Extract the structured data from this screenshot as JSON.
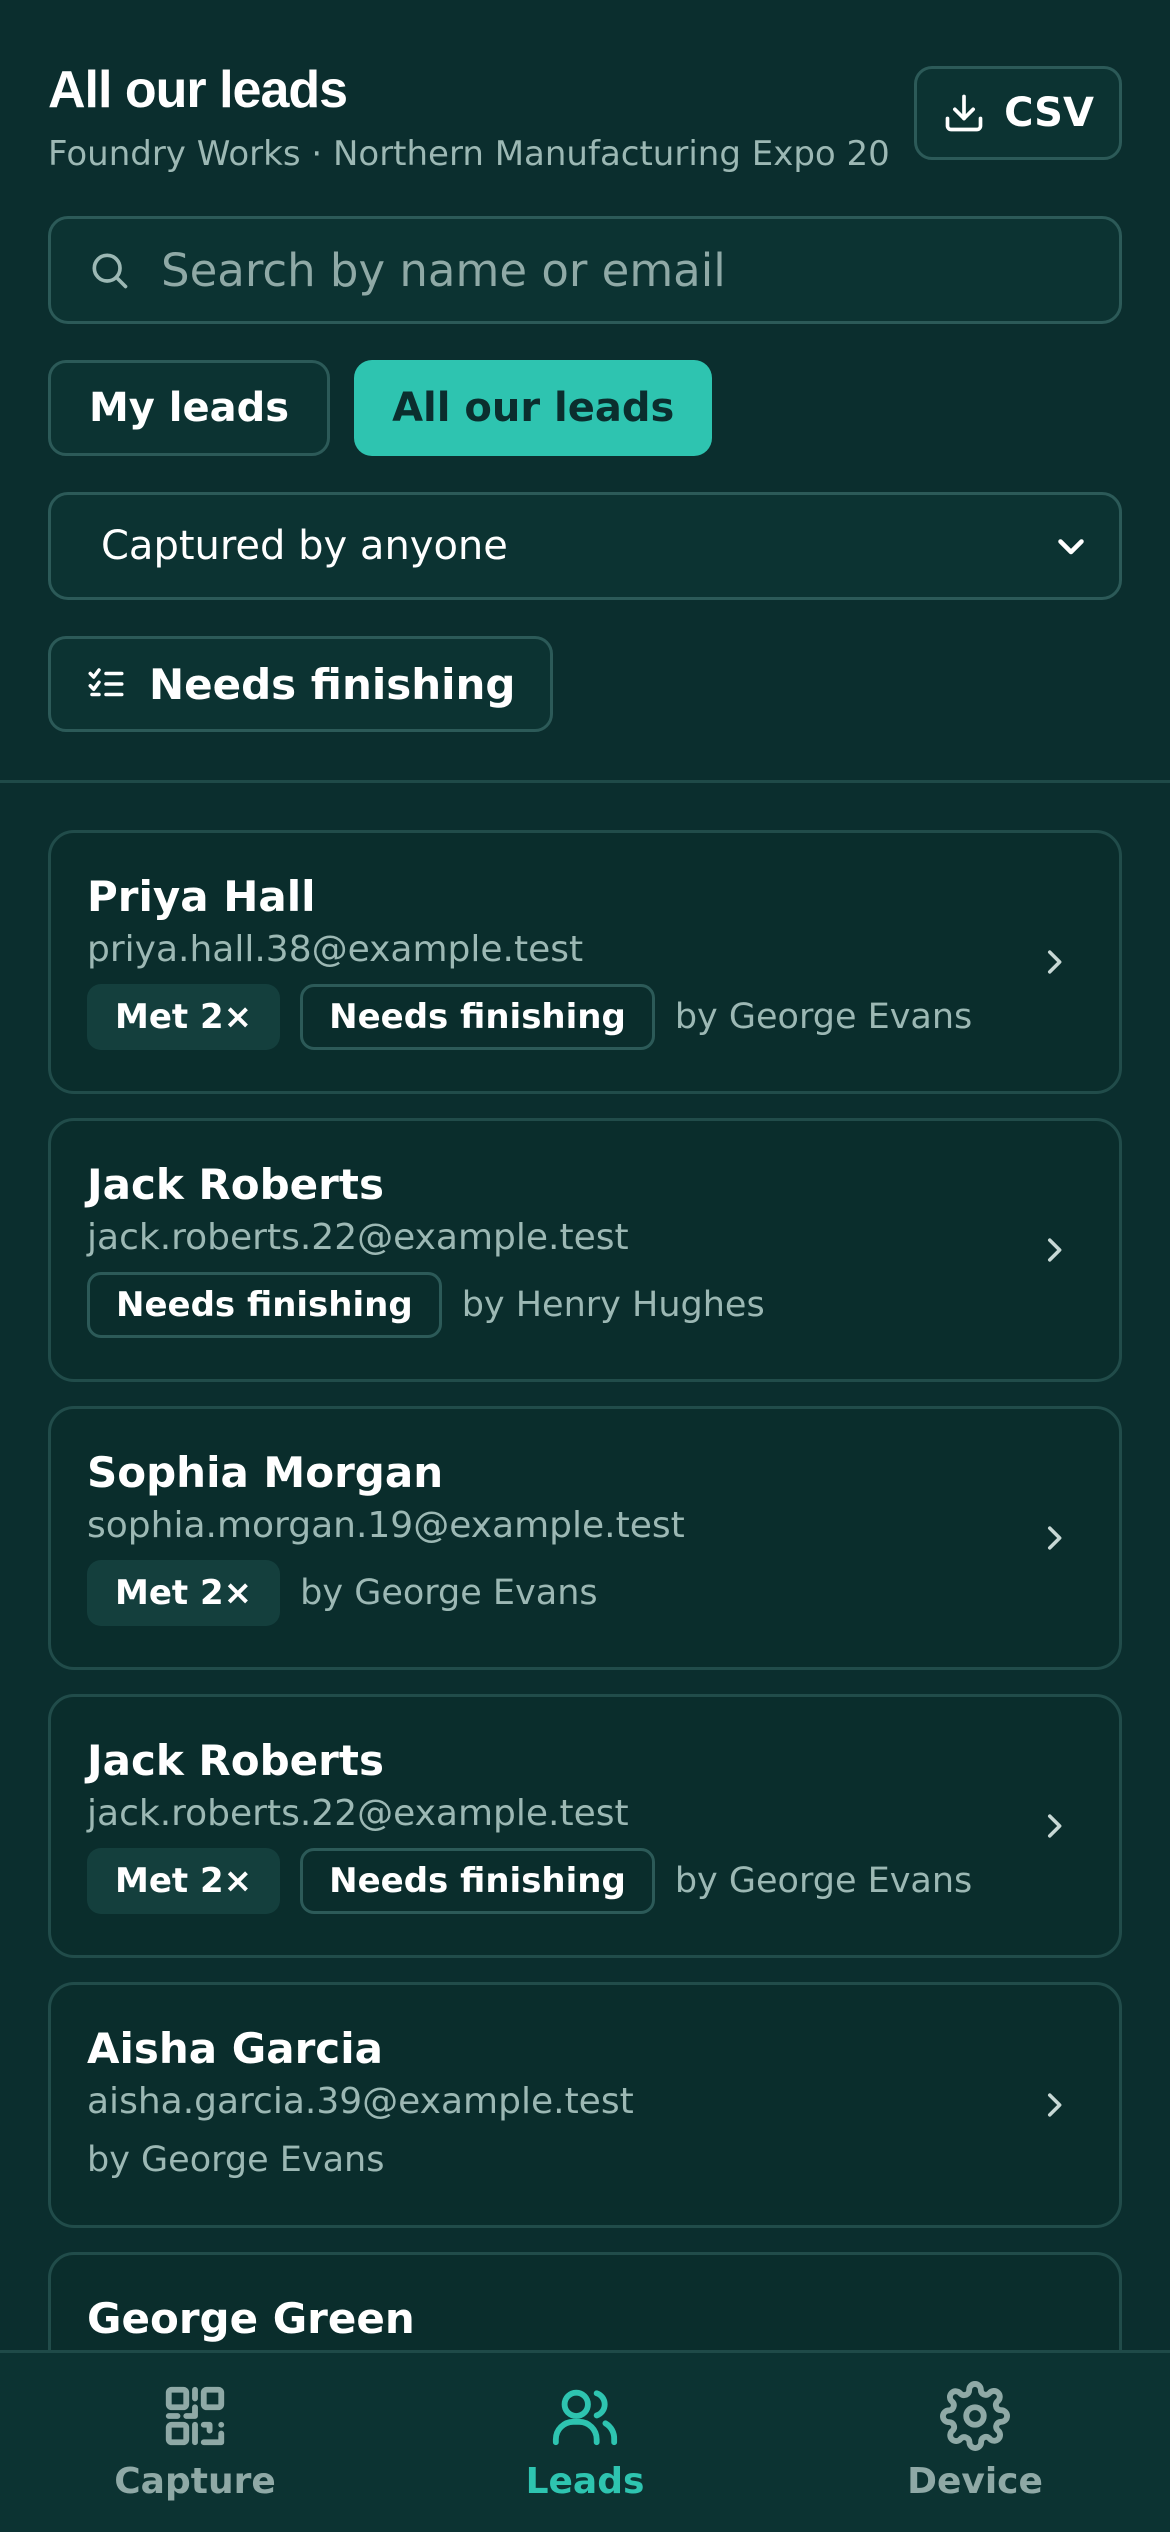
{
  "header": {
    "title": "All our leads",
    "subtitle": "Foundry Works · Northern Manufacturing Expo 20...",
    "csv_label": "CSV"
  },
  "search": {
    "placeholder": "Search by name or email",
    "value": ""
  },
  "segments": {
    "my_leads": "My leads",
    "all_leads": "All our leads",
    "selected": "All our leads"
  },
  "captured_filter": {
    "selected": "Captured by anyone"
  },
  "needs_filter": {
    "label": "Needs finishing"
  },
  "leads": [
    {
      "name": "Priya Hall",
      "email": "priya.hall.38@example.test",
      "met": "Met 2×",
      "needs": "Needs finishing",
      "by": "by George Evans"
    },
    {
      "name": "Jack Roberts",
      "email": "jack.roberts.22@example.test",
      "met": "",
      "needs": "Needs finishing",
      "by": "by Henry Hughes"
    },
    {
      "name": "Sophia Morgan",
      "email": "sophia.morgan.19@example.test",
      "met": "Met 2×",
      "needs": "",
      "by": "by George Evans"
    },
    {
      "name": "Jack Roberts",
      "email": "jack.roberts.22@example.test",
      "met": "Met 2×",
      "needs": "Needs finishing",
      "by": "by George Evans"
    },
    {
      "name": "Aisha Garcia",
      "email": "aisha.garcia.39@example.test",
      "met": "",
      "needs": "",
      "by": "by George Evans"
    },
    {
      "name": "George Green",
      "email": "",
      "met": "",
      "needs": "",
      "by": ""
    }
  ],
  "nav": [
    {
      "label": "Capture",
      "icon": "qr-code-icon",
      "active": false
    },
    {
      "label": "Leads",
      "icon": "users-icon",
      "active": true
    },
    {
      "label": "Device",
      "icon": "gear-icon",
      "active": false
    }
  ],
  "colors": {
    "background": "#0b2e2e",
    "accent": "#2ec4b0",
    "border": "#2c5a58",
    "muted_text": "#9cb8b4"
  }
}
